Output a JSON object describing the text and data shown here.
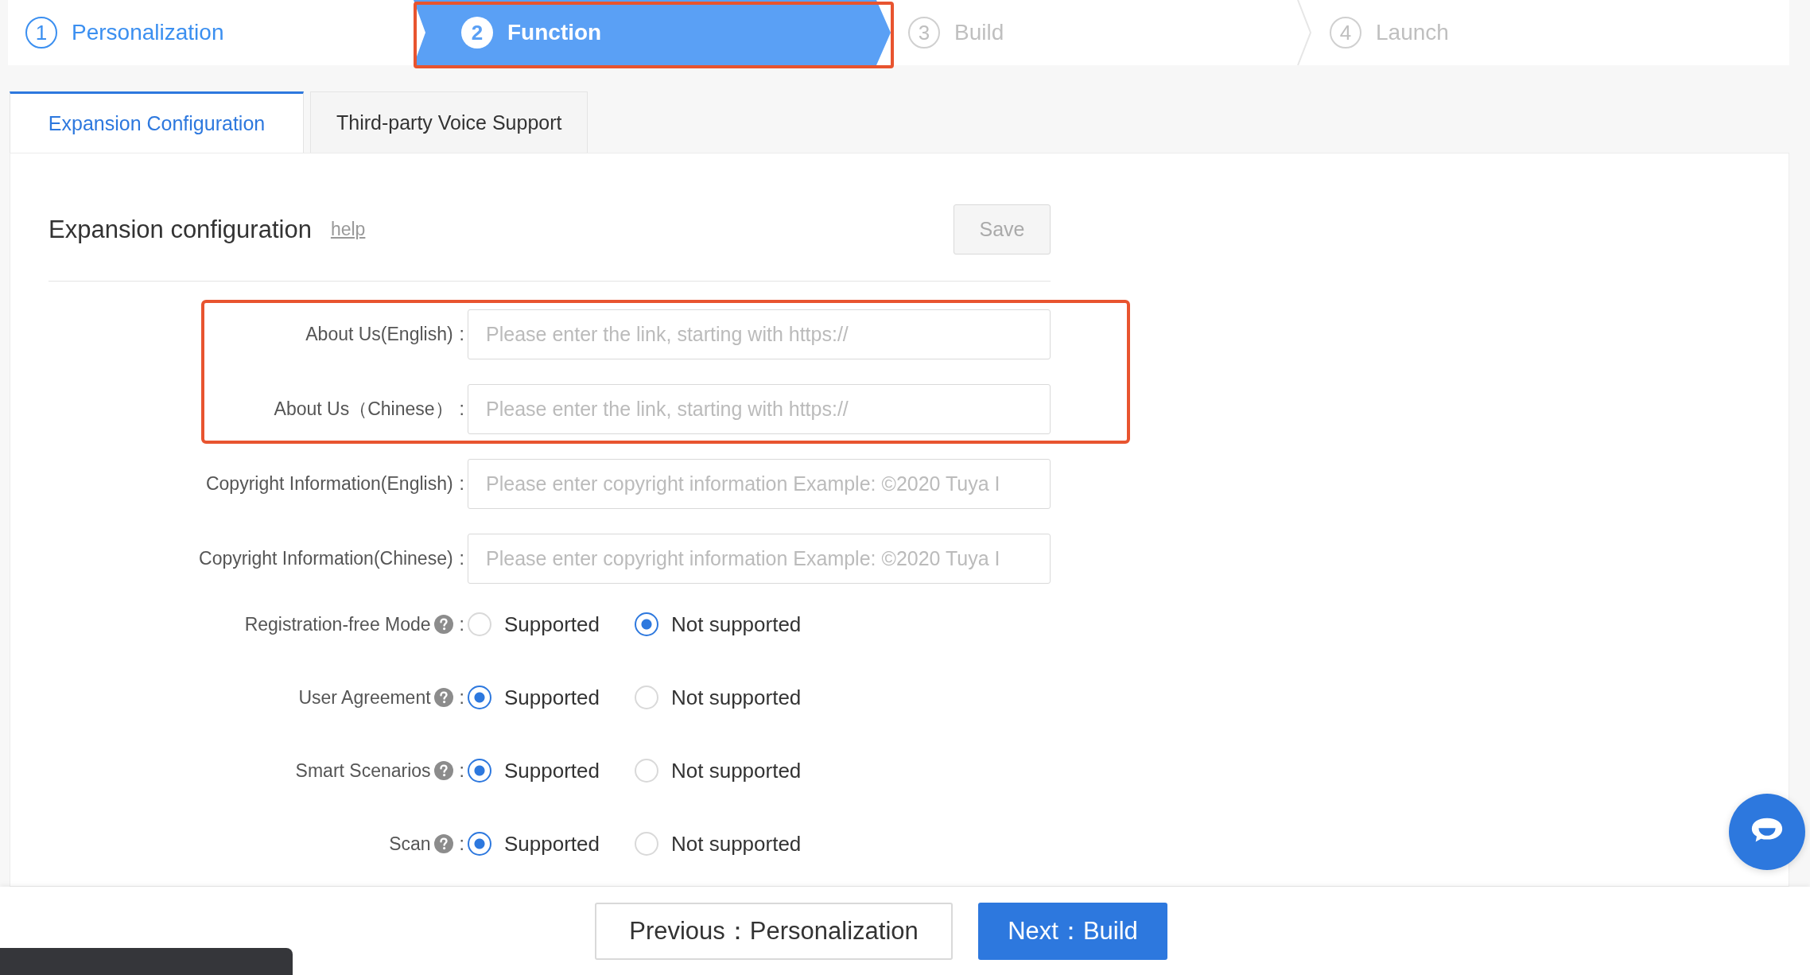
{
  "steps": [
    {
      "number": "1",
      "label": "Personalization",
      "completed": true,
      "selected": false,
      "highlighted": false
    },
    {
      "number": "2",
      "label": "Function",
      "completed": false,
      "selected": true,
      "highlighted": true
    },
    {
      "number": "3",
      "label": "Build",
      "completed": false,
      "selected": false,
      "highlighted": false
    },
    {
      "number": "4",
      "label": "Launch",
      "completed": false,
      "selected": false,
      "highlighted": false
    }
  ],
  "tabs": [
    {
      "label": "Expansion Configuration",
      "selected": true
    },
    {
      "label": "Third-party Voice Support",
      "selected": false
    }
  ],
  "section": {
    "title": "Expansion configuration",
    "help_link": "help",
    "save_button": "Save",
    "save_disabled": true
  },
  "field_groups": [
    {
      "highlighted": true,
      "fields": [
        {
          "label": "About Us(English)",
          "colon": ":",
          "placeholder": "Please enter the link, starting with https://"
        },
        {
          "label": "About Us（Chinese）",
          "colon": ":",
          "placeholder": "Please enter the link, starting with https://"
        }
      ]
    },
    {
      "highlighted": false,
      "fields": [
        {
          "label": "Copyright Information(English)",
          "colon": ":",
          "placeholder": "Please enter copyright information Example: ©2020 Tuya I"
        },
        {
          "label": "Copyright Information(Chinese)",
          "colon": ":",
          "placeholder": "Please enter copyright information Example: ©2020 Tuya I"
        }
      ]
    }
  ],
  "radio_rows": [
    {
      "label": "Registration-free Mode",
      "colon": ":",
      "options": [
        {
          "label": "Supported",
          "selected": false
        },
        {
          "label": "Not supported",
          "selected": true
        }
      ]
    },
    {
      "label": "User Agreement",
      "colon": ":",
      "options": [
        {
          "label": "Supported",
          "selected": true
        },
        {
          "label": "Not supported",
          "selected": false
        }
      ]
    },
    {
      "label": "Smart Scenarios",
      "colon": ":",
      "options": [
        {
          "label": "Supported",
          "selected": true
        },
        {
          "label": "Not supported",
          "selected": false
        }
      ]
    },
    {
      "label": "Scan",
      "colon": ":",
      "options": [
        {
          "label": "Supported",
          "selected": true
        },
        {
          "label": "Not supported",
          "selected": false
        }
      ]
    }
  ],
  "footer": {
    "previous_button": "Previous：Personalization",
    "next_button": "Next：Build"
  }
}
